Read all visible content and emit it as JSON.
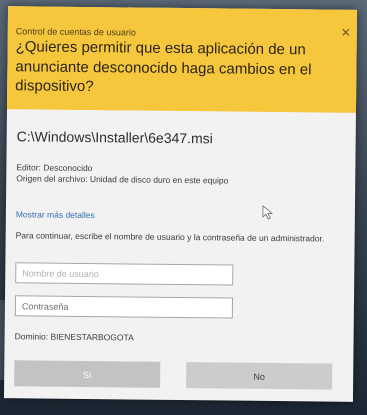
{
  "header": {
    "uac_label": "Control de cuentas de usuario",
    "close": "✕",
    "question": "¿Quieres permitir que esta aplicación de un anunciante desconocido haga cambios en el dispositivo?"
  },
  "program": {
    "path": "C:\\Windows\\Installer\\6e347.msi",
    "publisher": "Editor: Desconocido",
    "origin": "Origen del archivo: Unidad de disco duro en este equipo"
  },
  "more_details_link": "Mostrar más detalles",
  "instruction": "Para continuar, escribe el nombre de usuario y la contraseña de un administrador.",
  "fields": {
    "username_placeholder": "Nombre de usuario",
    "password_placeholder": "Contraseña"
  },
  "domain": "Dominio: BIENESTARBOGOTA",
  "buttons": {
    "yes": "Sí",
    "no": "No"
  },
  "colors": {
    "header_bg": "#f6c63c",
    "link": "#2f6db3"
  },
  "icons": {
    "close": "close-icon",
    "cursor": "mouse-cursor-icon"
  }
}
